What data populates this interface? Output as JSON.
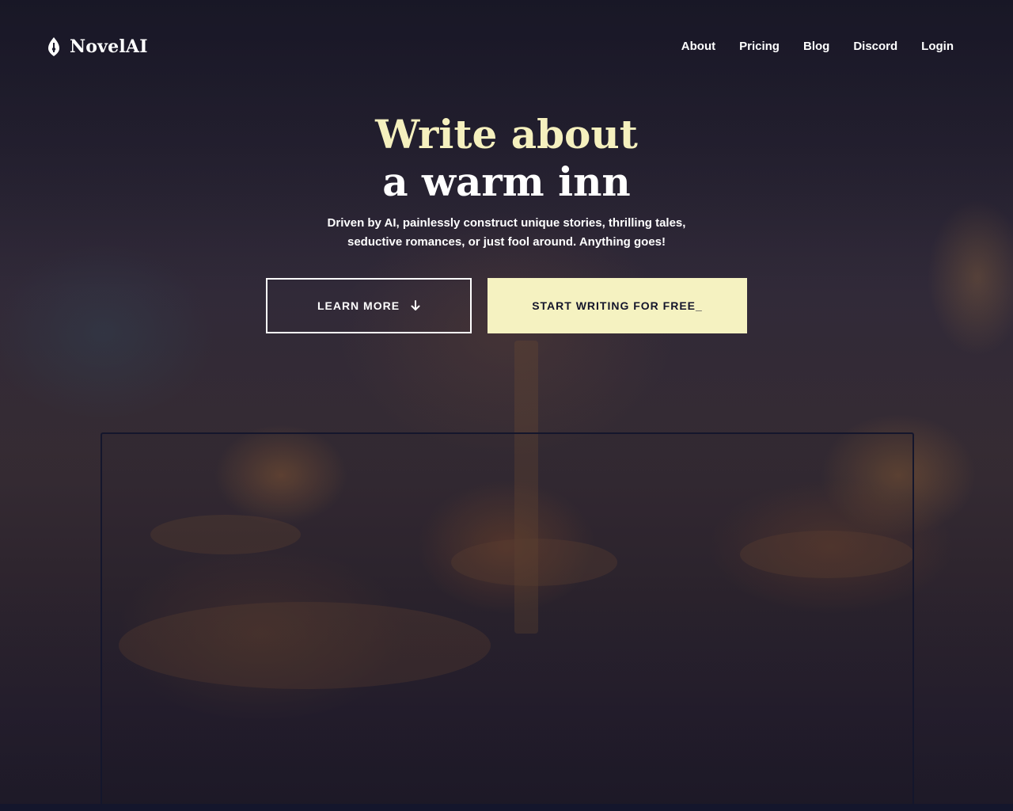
{
  "header": {
    "logo_icon": "quill-nib-icon",
    "logo_text": "NovelAI",
    "nav": [
      {
        "label": "About"
      },
      {
        "label": "Pricing"
      },
      {
        "label": "Blog"
      },
      {
        "label": "Discord"
      },
      {
        "label": "Login"
      }
    ]
  },
  "hero": {
    "title_line1": "Write about",
    "title_line2": "a warm inn",
    "subtitle": "Driven by AI, painlessly construct unique stories, thrilling tales, seductive romances, or just fool around. Anything goes!",
    "learn_more_label": "LEARN MORE",
    "learn_more_icon": "arrow-down-icon",
    "start_writing_label": "START WRITING FOR FREE_"
  },
  "colors": {
    "accent_title": "#f5f0be",
    "primary_button": "#f5f2c1",
    "dark_navy": "#14162c"
  }
}
